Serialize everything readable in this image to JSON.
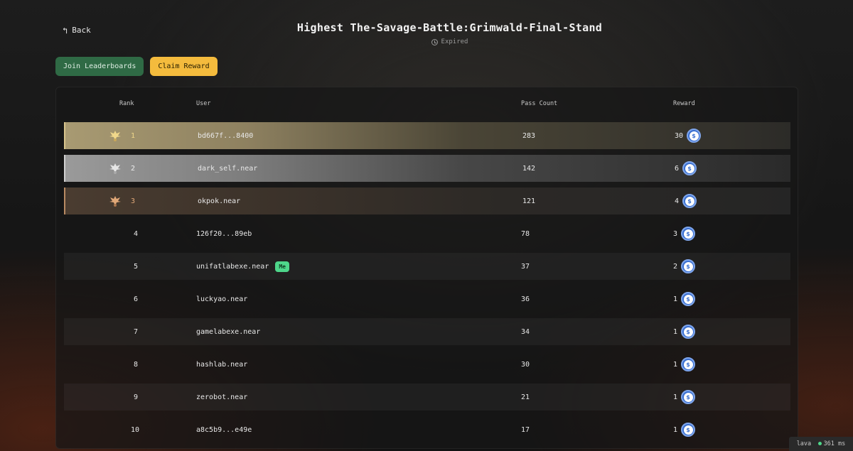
{
  "header": {
    "back_label": "Back",
    "title": "Highest The-Savage-Battle:Grimwald-Final-Stand",
    "status": "Expired"
  },
  "actions": {
    "join_label": "Join Leaderboards",
    "claim_label": "Claim Reward"
  },
  "table": {
    "columns": [
      "Rank",
      "User",
      "Pass Count",
      "Reward"
    ],
    "rows": [
      {
        "rank": "1",
        "user": "bd667f...8400",
        "pass_count": "283",
        "reward": "30",
        "tier": "gold"
      },
      {
        "rank": "2",
        "user": "dark_self.near",
        "pass_count": "142",
        "reward": "6",
        "tier": "silver"
      },
      {
        "rank": "3",
        "user": "okpok.near",
        "pass_count": "121",
        "reward": "4",
        "tier": "bronze"
      },
      {
        "rank": "4",
        "user": "126f20...89eb",
        "pass_count": "78",
        "reward": "3"
      },
      {
        "rank": "5",
        "user": "unifatlabexe.near",
        "pass_count": "37",
        "reward": "2",
        "badge": "Me"
      },
      {
        "rank": "6",
        "user": "luckyao.near",
        "pass_count": "36",
        "reward": "1"
      },
      {
        "rank": "7",
        "user": "gamelabexe.near",
        "pass_count": "34",
        "reward": "1"
      },
      {
        "rank": "8",
        "user": "hashlab.near",
        "pass_count": "30",
        "reward": "1"
      },
      {
        "rank": "9",
        "user": "zerobot.near",
        "pass_count": "21",
        "reward": "1"
      },
      {
        "rank": "10",
        "user": "a8c5b9...e49e",
        "pass_count": "17",
        "reward": "1"
      }
    ]
  },
  "footer": {
    "network": "lava",
    "latency": "361 ms"
  },
  "icons": {
    "back": "arrow-back-icon",
    "status": "clock-icon",
    "medal": "eagle-medal-icon",
    "reward": "coin-icon"
  },
  "colors": {
    "join_button": "#2f6a45",
    "claim_button": "#f4bb3d",
    "me_badge": "#4ed68a",
    "coin": "#3a6fd0",
    "gold": "#d8c48c",
    "silver": "#d0d0d0",
    "bronze": "#b88a62"
  }
}
